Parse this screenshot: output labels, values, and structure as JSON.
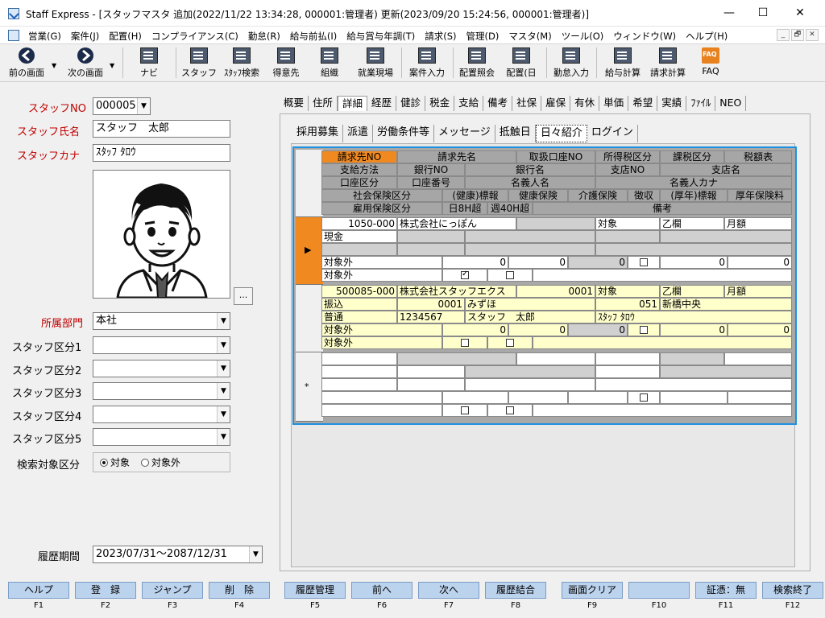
{
  "window": {
    "title": "Staff Express - [スタッフマスタ  追加(2022/11/22 13:34:28, 000001:管理者)  更新(2023/09/20 15:24:56, 000001:管理者)]",
    "minimize": "—",
    "maximize": "☐",
    "close": "✕"
  },
  "menu": {
    "items": [
      "営業(G)",
      "案件(J)",
      "配置(H)",
      "コンプライアンス(C)",
      "勤怠(R)",
      "給与前払(I)",
      "給与賞与年調(T)",
      "請求(S)",
      "管理(D)",
      "マスタ(M)",
      "ツール(O)",
      "ウィンドウ(W)",
      "ヘルプ(H)"
    ],
    "mdi": [
      "_",
      "🗗",
      "✕"
    ]
  },
  "toolbar": {
    "items": [
      "前の画面",
      "次の画面",
      "ナビ",
      "スタッフ",
      "ｽﾀｯﾌ検索",
      "得意先",
      "組織",
      "就業現場",
      "案件入力",
      "配置照会",
      "配置(日",
      "勤怠入力",
      "給与計算",
      "請求計算",
      "FAQ"
    ],
    "faq_icon_text": "FAQ"
  },
  "left": {
    "staff_no_label": "スタッフNO",
    "staff_no_value": "000005",
    "staff_name_label": "スタッフ氏名",
    "staff_name_value": "スタッフ　太郎",
    "staff_kana_label": "スタッフカナ",
    "staff_kana_value": "ｽﾀｯﾌ ﾀﾛｳ",
    "photo_button": "...",
    "dept_label": "所属部門",
    "dept_value": "本社",
    "kubun_labels": [
      "スタッフ区分1",
      "スタッフ区分2",
      "スタッフ区分3",
      "スタッフ区分4",
      "スタッフ区分5"
    ],
    "search_label": "検索対象区分",
    "search_options": [
      "対象",
      "対象外"
    ],
    "search_selected": "対象",
    "history_label": "履歴期間",
    "history_value": "2023/07/31～2087/12/31"
  },
  "tabs_main": [
    "概要",
    "住所",
    "詳細",
    "経歴",
    "健診",
    "税金",
    "支給",
    "備考",
    "社保",
    "雇保",
    "有休",
    "単価",
    "希望",
    "実績",
    "ﾌｧｲﾙ",
    "NEO"
  ],
  "tabs_main_active": "詳細",
  "tabs_sub": [
    "採用募集",
    "派遣",
    "労働条件等",
    "メッセージ",
    "抵触日",
    "日々紹介",
    "ログイン"
  ],
  "tabs_sub_active": "日々紹介",
  "grid": {
    "h1": [
      "請求先NO",
      "請求先名",
      "取扱口座NO",
      "所得税区分",
      "課税区分",
      "税額表"
    ],
    "h2": [
      "支給方法",
      "銀行NO",
      "銀行名",
      "支店NO",
      "支店名"
    ],
    "h3": [
      "口座区分",
      "口座番号",
      "名義人名",
      "名義人カナ"
    ],
    "h4": [
      "社会保険区分",
      "(健康)標報",
      "健康保険",
      "介護保険",
      "徴収",
      "(厚年)標報",
      "厚年保険料"
    ],
    "h5": [
      "雇用保険区分",
      "日8H超",
      "週40H超",
      "備考"
    ],
    "rec1": {
      "billing_no": "1050-000",
      "billing_name": "株式会社にっぽん",
      "tax_kubun": "対象",
      "kazei": "乙欄",
      "table": "月額",
      "pay_method": "現金",
      "shaho": "対象外",
      "hyouhou": "0",
      "kenpo": "0",
      "kaigo": "0",
      "kounen": "0",
      "nenkin": "0",
      "koyo": "対象外",
      "over8": "checked",
      "over40": "unchecked"
    },
    "rec2": {
      "billing_no": "500085-000",
      "billing_name": "株式会社スタッフエクス",
      "account_no": "0001",
      "tax_kubun": "対象",
      "kazei": "乙欄",
      "table": "月額",
      "pay_method": "振込",
      "bank_no": "0001",
      "bank_name": "みずほ",
      "branch_no": "051",
      "branch_name": "新橋中央",
      "acct_kubun": "普通",
      "acct_number": "1234567",
      "holder": "スタッフ　太郎",
      "holder_kana": "ｽﾀｯﾌ ﾀﾛｳ",
      "shaho": "対象外",
      "hyouhou": "0",
      "kenpo": "0",
      "kaigo": "0",
      "kounen": "0",
      "nenkin": "0",
      "koyo": "対象外"
    },
    "new_row_marker": "*"
  },
  "fkeys": [
    {
      "label": "ヘルプ",
      "key": "F1"
    },
    {
      "label": "登　録",
      "key": "F2"
    },
    {
      "label": "ジャンプ",
      "key": "F3"
    },
    {
      "label": "削　除",
      "key": "F4"
    },
    {
      "label": "履歴管理",
      "key": "F5"
    },
    {
      "label": "前へ",
      "key": "F6"
    },
    {
      "label": "次へ",
      "key": "F7"
    },
    {
      "label": "履歴結合",
      "key": "F8"
    },
    {
      "label": "画面クリア",
      "key": "F9"
    },
    {
      "label": "",
      "key": "F10"
    },
    {
      "label": "証憑：無",
      "key": "F11"
    },
    {
      "label": "検索終了",
      "key": "F12"
    }
  ],
  "colors": {
    "accent": "#1e90e0",
    "selected_header": "#f08a20",
    "highlight_row": "#ffffcc",
    "required_label": "#c00000",
    "fkey": "#bcd3ee"
  }
}
